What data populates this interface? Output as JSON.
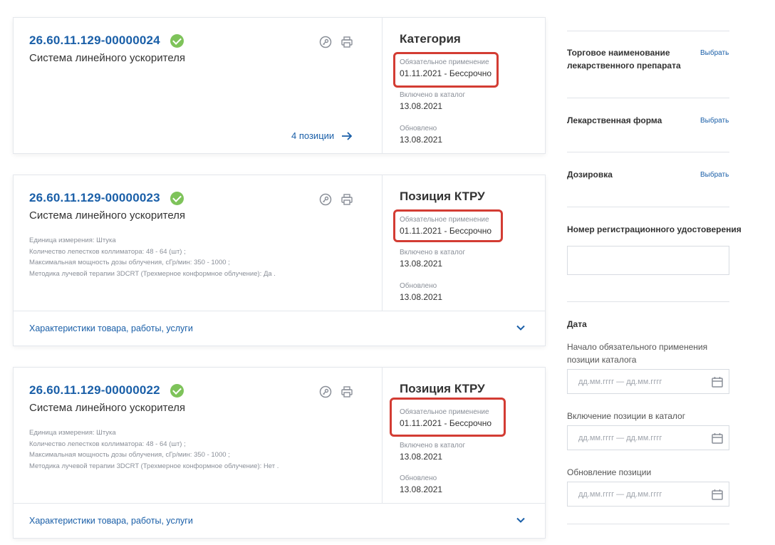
{
  "cards": [
    {
      "code": "26.60.11.129-00000024",
      "name": "Система линейного ускорителя",
      "type": "Категория",
      "mandatory_label": "Обязательное применение",
      "mandatory_value": "01.11.2021  - Бессрочно",
      "included_label": "Включено в каталог",
      "included_value": "13.08.2021",
      "updated_label": "Обновлено",
      "updated_value": "13.08.2021",
      "positions_link": "4 позиции"
    },
    {
      "code": "26.60.11.129-00000023",
      "name": "Система линейного ускорителя",
      "type": "Позиция КТРУ",
      "props": [
        "Единица измерения: Штука",
        "Количество лепестков коллиматора: 48  -  64 (шт) ;",
        "Максимальная мощность дозы облучения, сГр/мин: 350  -  1000 ;",
        "Методика лучевой терапии 3DCRT (Трехмерное конформное облучение): Да ."
      ],
      "mandatory_label": "Обязательное применение",
      "mandatory_value": "01.11.2021  - Бессрочно",
      "included_label": "Включено в каталог",
      "included_value": "13.08.2021",
      "updated_label": "Обновлено",
      "updated_value": "13.08.2021",
      "footer": "Характеристики товара, работы, услуги"
    },
    {
      "code": "26.60.11.129-00000022",
      "name": "Система линейного ускорителя",
      "type": "Позиция КТРУ",
      "props": [
        "Единица измерения: Штука",
        "Количество лепестков коллиматора: 48  -  64 (шт) ;",
        "Максимальная мощность дозы облучения, сГр/мин: 350  -  1000 ;",
        "Методика лучевой терапии 3DCRT (Трехмерное конформное облучение): Нет ."
      ],
      "mandatory_label": "Обязательное применение",
      "mandatory_value": "01.11.2021  - Бессрочно",
      "included_label": "Включено в каталог",
      "included_value": "13.08.2021",
      "updated_label": "Обновлено",
      "updated_value": "13.08.2021",
      "footer": "Характеристики товара, работы, услуги"
    }
  ],
  "filters": {
    "trade_name_line1": "Торговое наименование",
    "trade_name_line2": "лекарственного препарата",
    "form": "Лекарственная форма",
    "dosage": "Дозировка",
    "choose": "Выбрать",
    "reg_number": "Номер регистрационного удостоверения",
    "date_title": "Дата",
    "start_line1": "Начало обязательного применения",
    "start_line2": "позиции каталога",
    "inclusion": "Включение позиции в каталог",
    "update": "Обновление позиции",
    "date_placeholder": "дд.мм.гггг — дд.мм.гггг"
  },
  "colors": {
    "link": "#1a5fa8",
    "success": "#7ec35a",
    "highlight": "#d33c33"
  }
}
